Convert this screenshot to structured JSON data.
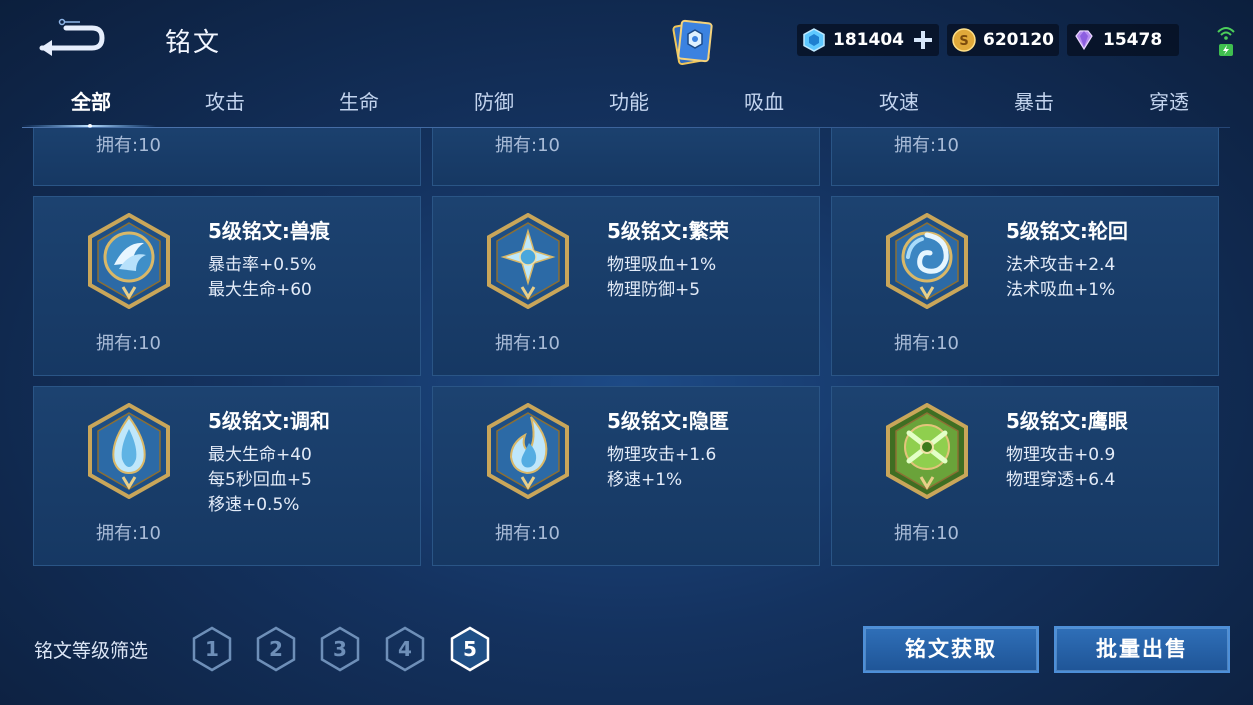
{
  "header": {
    "title": "铭文",
    "currencies": [
      {
        "icon": "diamond-coupon-icon",
        "value": "181404"
      },
      {
        "icon": "gold-coin-icon",
        "value": "620120"
      },
      {
        "icon": "purple-gem-icon",
        "value": "15478"
      }
    ]
  },
  "tabs": [
    {
      "label": "全部",
      "active": true
    },
    {
      "label": "攻击"
    },
    {
      "label": "生命"
    },
    {
      "label": "防御"
    },
    {
      "label": "功能"
    },
    {
      "label": "吸血"
    },
    {
      "label": "攻速"
    },
    {
      "label": "暴击"
    },
    {
      "label": "穿透"
    }
  ],
  "partial_row": {
    "owned": [
      "拥有:10",
      "拥有:10",
      "拥有:10"
    ]
  },
  "runes": [
    {
      "name": "5级铭文:兽痕",
      "stats": [
        "暴击率+0.5%",
        "最大生命+60"
      ],
      "owned": "拥有:10",
      "icon": "beast-claw-rune-icon"
    },
    {
      "name": "5级铭文:繁荣",
      "stats": [
        "物理吸血+1%",
        "物理防御+5"
      ],
      "owned": "拥有:10",
      "icon": "prosperity-star-rune-icon"
    },
    {
      "name": "5级铭文:轮回",
      "stats": [
        "法术攻击+2.4",
        "法术吸血+1%"
      ],
      "owned": "拥有:10",
      "icon": "reincarnation-swirl-rune-icon"
    },
    {
      "name": "5级铭文:调和",
      "stats": [
        "最大生命+40",
        "每5秒回血+5",
        "移速+0.5%"
      ],
      "owned": "拥有:10",
      "icon": "harmony-drop-rune-icon"
    },
    {
      "name": "5级铭文:隐匿",
      "stats": [
        "物理攻击+1.6",
        "移速+1%"
      ],
      "owned": "拥有:10",
      "icon": "concealment-flame-rune-icon"
    },
    {
      "name": "5级铭文:鹰眼",
      "stats": [
        "物理攻击+0.9",
        "物理穿透+6.4"
      ],
      "owned": "拥有:10",
      "icon": "hawk-eye-rune-icon"
    }
  ],
  "footer": {
    "filter_label": "铭文等级筛选",
    "levels": [
      "1",
      "2",
      "3",
      "4",
      "5"
    ],
    "selected_level": "5",
    "acquire_label": "铭文获取",
    "bulk_sell_label": "批量出售"
  },
  "colors": {
    "accent": "#4d8fd8",
    "gold_frame": "#c9a65a",
    "card_bg": "#1c4270",
    "hawk_green": "#6aa33a"
  }
}
